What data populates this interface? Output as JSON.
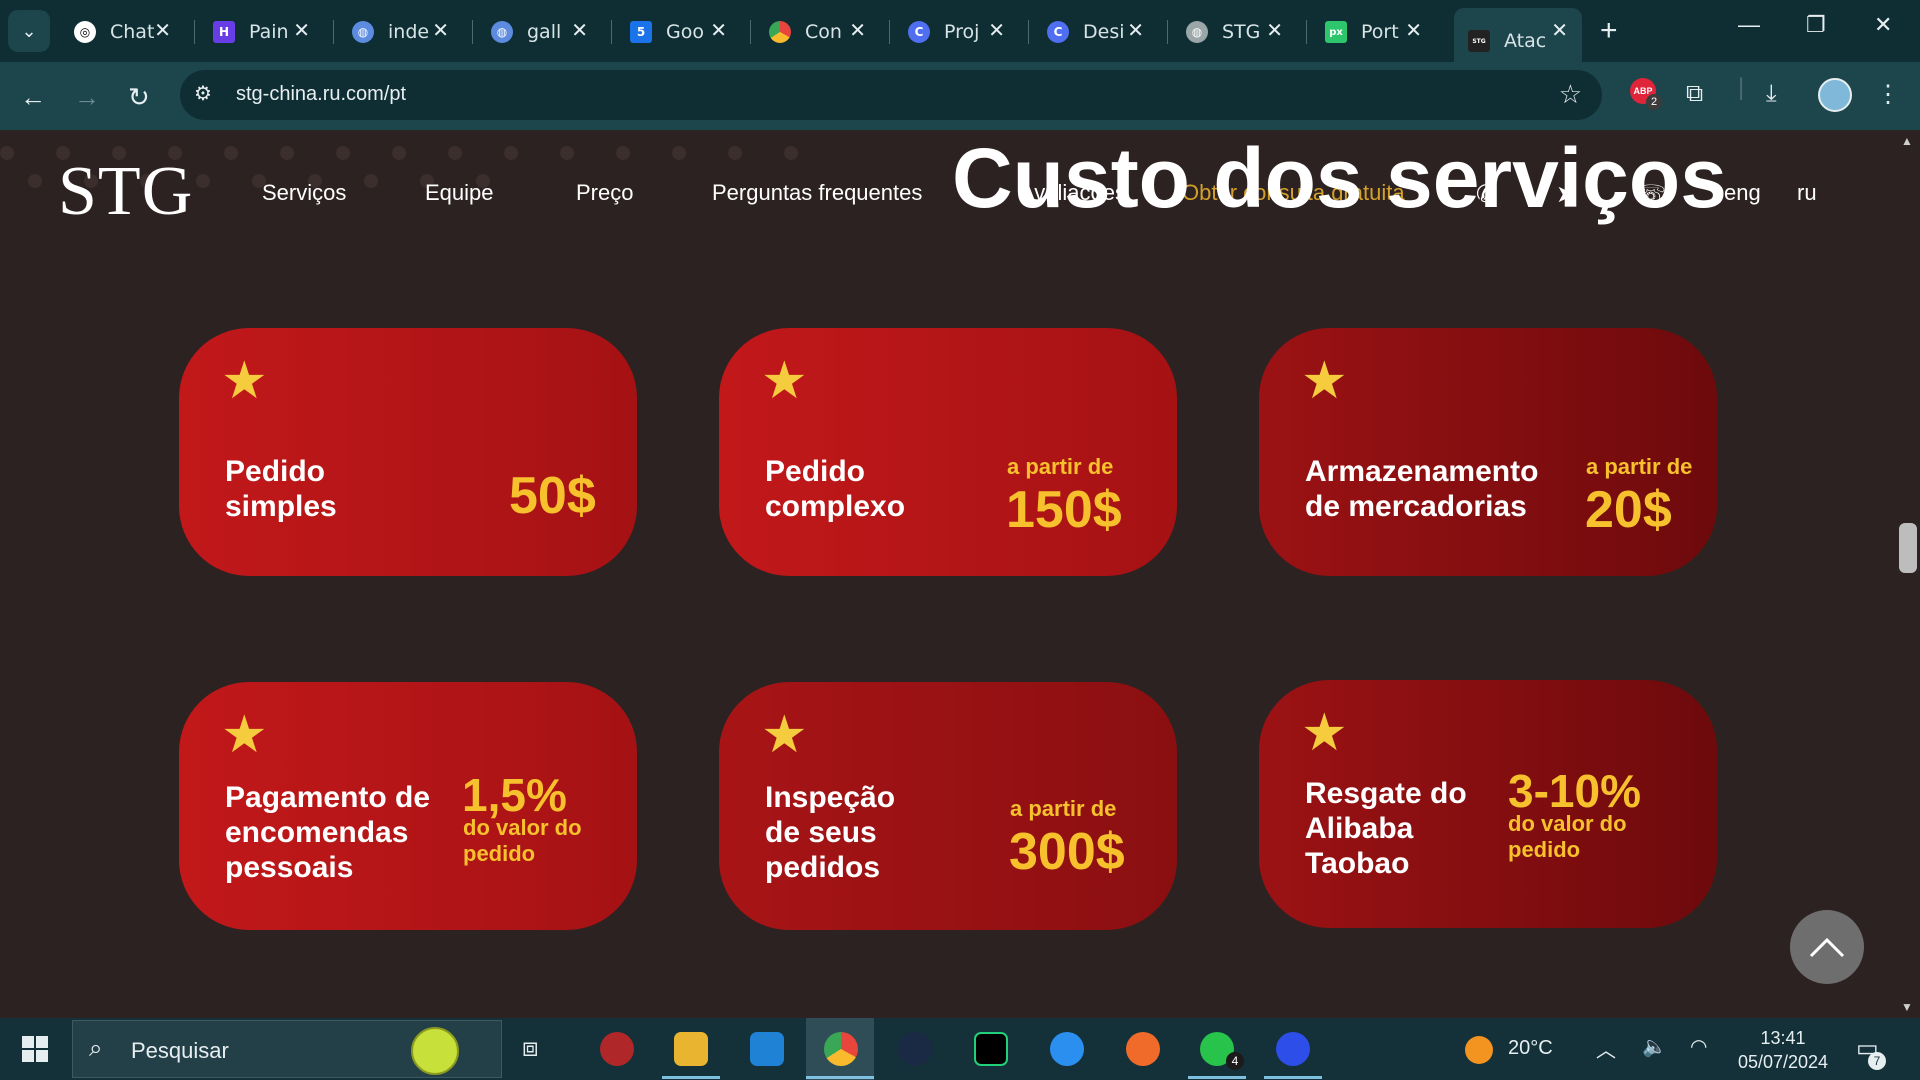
{
  "browser": {
    "tabs": [
      {
        "title": "Chat",
        "icon": "chatgpt-icon",
        "color": "#ffffff"
      },
      {
        "title": "Pain",
        "icon": "hostinger-icon",
        "color": "#673de6"
      },
      {
        "title": "inde",
        "icon": "globe-blue-icon",
        "color": "#5c8be0"
      },
      {
        "title": "gall",
        "icon": "globe-blue-icon",
        "color": "#5c8be0"
      },
      {
        "title": "Goo",
        "icon": "google-calendar-icon",
        "color": "#1a73e8"
      },
      {
        "title": "Con",
        "icon": "chrome-icon",
        "color": "#e8a317"
      },
      {
        "title": "Proj",
        "icon": "canva-icon",
        "color": "#4f6ef0"
      },
      {
        "title": "Desi",
        "icon": "canva-icon",
        "color": "#4f6ef0"
      },
      {
        "title": "STG",
        "icon": "globe-icon",
        "color": "#9aa6a8"
      },
      {
        "title": "Port",
        "icon": "pixabay-icon",
        "color": "#2ec66d"
      },
      {
        "title": "Atac",
        "icon": "stg-favicon",
        "color": "#222222"
      }
    ],
    "url": "stg-china.ru.com/pt",
    "extension_badge": "2"
  },
  "site": {
    "logo": "STG",
    "nav": [
      "Serviços",
      "Equipe",
      "Preço",
      "Perguntas frequentes",
      "Avaliações",
      "Obter consulta gratuita",
      "eng",
      "ru"
    ],
    "section_title": "Custo dos serviços"
  },
  "cards": [
    {
      "title_lines": [
        "Pedido",
        "simples"
      ],
      "pre": "",
      "price": "50$",
      "post_lines": []
    },
    {
      "title_lines": [
        "Pedido",
        "complexo"
      ],
      "pre": "a partir de",
      "price": "150$",
      "post_lines": []
    },
    {
      "title_lines": [
        "Armazenamento",
        "de mercadorias"
      ],
      "pre": "a partir de",
      "price": "20$",
      "post_lines": []
    },
    {
      "title_lines": [
        "Pagamento de",
        "encomendas",
        "pessoais"
      ],
      "pre": "",
      "price": "1,5%",
      "post_lines": [
        "do valor do",
        "pedido"
      ]
    },
    {
      "title_lines": [
        "Inspeção",
        "de seus",
        "pedidos"
      ],
      "pre": "a partir de",
      "price": "300$",
      "post_lines": []
    },
    {
      "title_lines": [
        "Resgate do",
        "Alibaba",
        "Taobao"
      ],
      "pre": "",
      "price": "3-10%",
      "post_lines": [
        "do valor do",
        "pedido"
      ]
    }
  ],
  "colors": {
    "card_red": "#c2181a",
    "card_dark_red": "#6d0a0c",
    "gold": "#f7c02d",
    "page_bg": "#2c2221"
  },
  "taskbar": {
    "search_placeholder": "Pesquisar",
    "weather": "20°C",
    "time": "13:41",
    "date": "05/07/2024",
    "notifications": "7",
    "whatsapp_badge": "4"
  }
}
